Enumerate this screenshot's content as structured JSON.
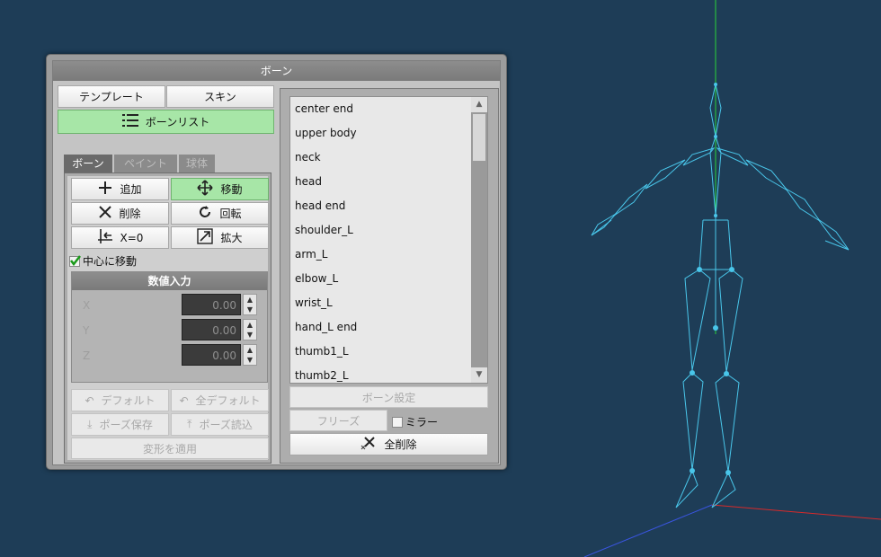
{
  "window": {
    "title": "ボーン"
  },
  "top_buttons": {
    "template": "テンプレート",
    "skin": "スキン",
    "bone_list": "ボーンリスト"
  },
  "tabs": [
    {
      "label": "ボーン",
      "active": true
    },
    {
      "label": "ペイント",
      "active": false
    },
    {
      "label": "球体",
      "active": false
    }
  ],
  "tools": {
    "add": "追加",
    "move": "移動",
    "delete": "削除",
    "rotate": "回転",
    "x_zero": "X=0",
    "scale": "拡大"
  },
  "move_to_center": {
    "label": "中心に移動",
    "checked": true
  },
  "numeric_input": {
    "title": "数値入力",
    "fields": [
      {
        "axis": "X",
        "value": "0.00"
      },
      {
        "axis": "Y",
        "value": "0.00"
      },
      {
        "axis": "Z",
        "value": "0.00"
      }
    ]
  },
  "pose_buttons": {
    "default": "デフォルト",
    "all_default": "全デフォルト",
    "save_pose": "ポーズ保存",
    "load_pose": "ポーズ読込",
    "apply_transform": "変形を適用"
  },
  "bone_list": [
    "center end",
    "upper body",
    "neck",
    "head",
    "head end",
    "shoulder_L",
    "arm_L",
    "elbow_L",
    "wrist_L",
    "hand_L end",
    "thumb1_L",
    "thumb2_L"
  ],
  "right_buttons": {
    "bone_settings": "ボーン設定",
    "freeze": "フリーズ",
    "mirror": "ミラー",
    "delete_all": "全削除"
  },
  "colors": {
    "viewport_bg": "#1e3d57",
    "skeleton": "#49c6ea",
    "active_button": "#a7e6a7"
  }
}
